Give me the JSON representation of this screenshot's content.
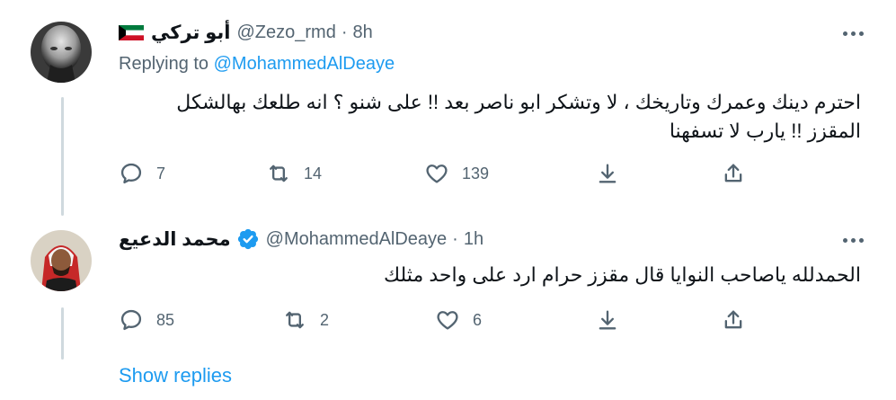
{
  "tweets": [
    {
      "display_name": "أبو تركي",
      "flag_icon": "kuwait-flag-icon",
      "handle": "@Zezo_rmd",
      "separator": "·",
      "time": "8h",
      "replying_label": "Replying to",
      "replying_to": "@MohammedAlDeaye",
      "text": "احترم دينك وعمرك وتاريخك ، لا وتشكر ابو ناصر بعد !! على شنو ؟ انه طلعك بهالشكل المقزز !! يارب لا تسفهنا",
      "reply_count": "7",
      "retweet_count": "14",
      "like_count": "139"
    },
    {
      "display_name": "محمد الدعيع",
      "verified_icon": "verified-badge-icon",
      "handle": "@MohammedAlDeaye",
      "separator": "·",
      "time": "1h",
      "text": "الحمدلله ياصاحب النوايا قال مقزز  حرام ارد على واحد مثلك",
      "reply_count": "85",
      "retweet_count": "2",
      "like_count": "6"
    }
  ],
  "show_replies": "Show replies",
  "colors": {
    "text_primary": "#0f1419",
    "text_secondary": "#536471",
    "accent": "#1d9bf0",
    "thread_line": "#cfd9de"
  }
}
